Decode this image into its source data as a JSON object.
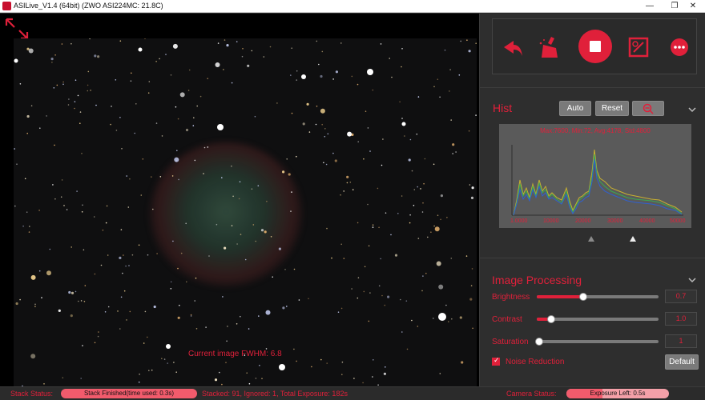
{
  "window": {
    "title": "ASILive_V1.4 (64bit)  (ZWO ASI224MC: 21.8C)",
    "minimize_icon": "minimize-icon",
    "restore_icon": "restore-icon",
    "close_icon": "close-icon"
  },
  "viewer": {
    "fwhm_text": "Current image FWHM: 6.8",
    "expand_icon": "expand-icon"
  },
  "toolbar": {
    "icons": [
      "back-icon",
      "clear-icon",
      "stop-icon",
      "save-image-icon",
      "more-icon"
    ]
  },
  "hist": {
    "title": "Hist",
    "auto_label": "Auto",
    "reset_label": "Reset",
    "zoom_icon": "zoom-out-icon",
    "info": "Max:7600, Min:72, Avg:4178, Std:4800",
    "ticks": [
      "1.0000",
      "10000",
      "20000",
      "30000",
      "40000",
      "50000"
    ],
    "slider_left": "dark-triangle",
    "slider_right": "light-triangle"
  },
  "image_processing": {
    "title": "Image Processing",
    "brightness": {
      "label": "Brightness",
      "value": "0.7",
      "level": 0.38
    },
    "contrast": {
      "label": "Contrast",
      "value": "1.0",
      "level": 0.12
    },
    "saturation": {
      "label": "Saturation",
      "value": "1",
      "level": 0.02
    },
    "noise_reduction": {
      "label": "Noise Reduction",
      "checked": true
    },
    "default_label": "Default"
  },
  "status": {
    "stack_status_label": "Stack Status:",
    "stack_status_text": "Stack Finished(time used: 0.3s)",
    "stacked_text": "Stacked: 91, Ignored: 1, Total Exposure: 182s",
    "camera_status_label": "Camera Status:",
    "exposure_text": "Exposure Left: 0.5s",
    "exposure_progress": 0.35
  },
  "colors": {
    "accent": "#e0203a",
    "panel": "#2e2e2e",
    "button": "#7a7a7a"
  }
}
